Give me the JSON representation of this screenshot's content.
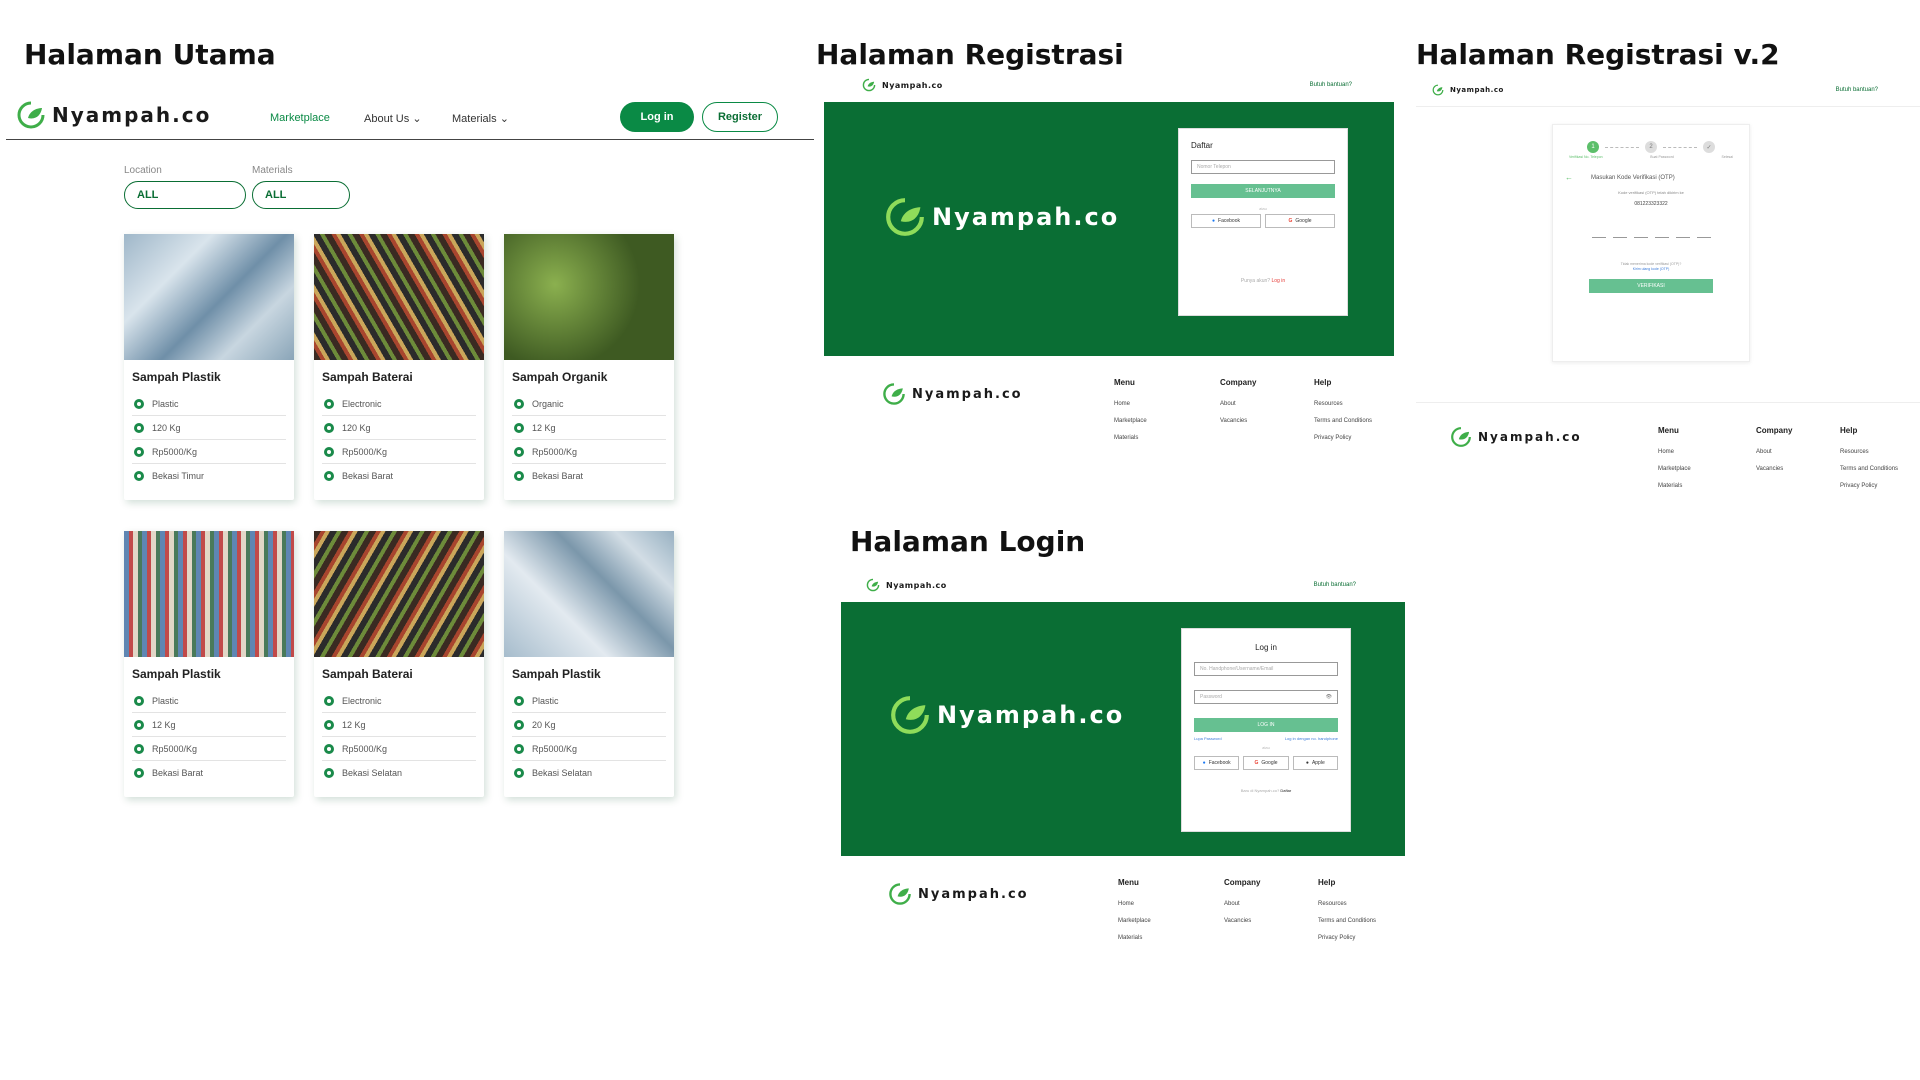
{
  "utama": {
    "title": "Halaman Utama",
    "brand": "Nyampah.co",
    "nav": {
      "marketplace": "Marketplace",
      "about": "About Us",
      "materials": "Materials",
      "login": "Log in",
      "register": "Register"
    },
    "filters": {
      "location_label": "Location",
      "location_value": "ALL",
      "materials_label": "Materials",
      "materials_value": "ALL"
    },
    "cards": [
      {
        "title": "Sampah Plastik",
        "type": "Plastic",
        "weight": "120 Kg",
        "price": "Rp5000/Kg",
        "location": "Bekasi Timur"
      },
      {
        "title": "Sampah Baterai",
        "type": "Electronic",
        "weight": "120 Kg",
        "price": "Rp5000/Kg",
        "location": "Bekasi Barat"
      },
      {
        "title": "Sampah Organik",
        "type": "Organic",
        "weight": "12 Kg",
        "price": "Rp5000/Kg",
        "location": "Bekasi Barat"
      },
      {
        "title": "Sampah Plastik",
        "type": "Plastic",
        "weight": "12 Kg",
        "price": "Rp5000/Kg",
        "location": "Bekasi Barat"
      },
      {
        "title": "Sampah Baterai",
        "type": "Electronic",
        "weight": "12 Kg",
        "price": "Rp5000/Kg",
        "location": "Bekasi Selatan"
      },
      {
        "title": "Sampah Plastik",
        "type": "Plastic",
        "weight": "20 Kg",
        "price": "Rp5000/Kg",
        "location": "Bekasi Selatan"
      }
    ]
  },
  "registrasi": {
    "title": "Halaman Registrasi",
    "brand": "Nyampah.co",
    "help": "Butuh bantuan?",
    "form_title": "Daftar",
    "phone_placeholder": "Nomor Telepon",
    "submit": "SELANJUTNYA",
    "or": "atau",
    "facebook": "Facebook",
    "google": "Google",
    "have_account": "Punya akun?",
    "login_link": "Log in"
  },
  "registrasi2": {
    "title": "Halaman Registrasi v.2",
    "brand": "Nyampah.co",
    "help": "Butuh bantuan?",
    "steps": [
      "1",
      "2",
      "✓"
    ],
    "step_labels": [
      "Verifikasi No. Telepon",
      "Buat Password",
      "Selesai"
    ],
    "otp_title": "Masukan Kode Verifikasi (OTP)",
    "otp_sub": "Kode verifikasi (OTP) telah dikirim ke",
    "phone": "081223323322",
    "resend": "Tidak menerima kode verifikasi (OTP)?",
    "resend_link": "Kirim ulang kode (OTP)",
    "verify": "VERIFIKASI"
  },
  "login": {
    "title": "Halaman Login",
    "brand": "Nyampah.co",
    "help": "Butuh bantuan?",
    "form_title": "Log in",
    "user_placeholder": "No. Handphone/Username/Email",
    "pass_placeholder": "Password",
    "submit": "LOG IN",
    "forgot": "Lupa Password",
    "login_phone": "Log in dengan no. handphone",
    "or": "atau",
    "facebook": "Facebook",
    "google": "Google",
    "apple": "Apple",
    "new_user": "Baru di Nyampah.co?",
    "signup": "Daftar"
  },
  "footer": {
    "brand": "Nyampah.co",
    "menu": {
      "title": "Menu",
      "items": [
        "Home",
        "Marketplace",
        "Materials"
      ]
    },
    "company": {
      "title": "Company",
      "items": [
        "About",
        "Vacancies"
      ]
    },
    "help": {
      "title": "Help",
      "items": [
        "Resources",
        "Terms and Conditions",
        "Privacy Policy"
      ]
    }
  },
  "colors": {
    "brand_green": "#0a6e34",
    "button_green": "#0a8a45",
    "light_green": "#66c091"
  }
}
